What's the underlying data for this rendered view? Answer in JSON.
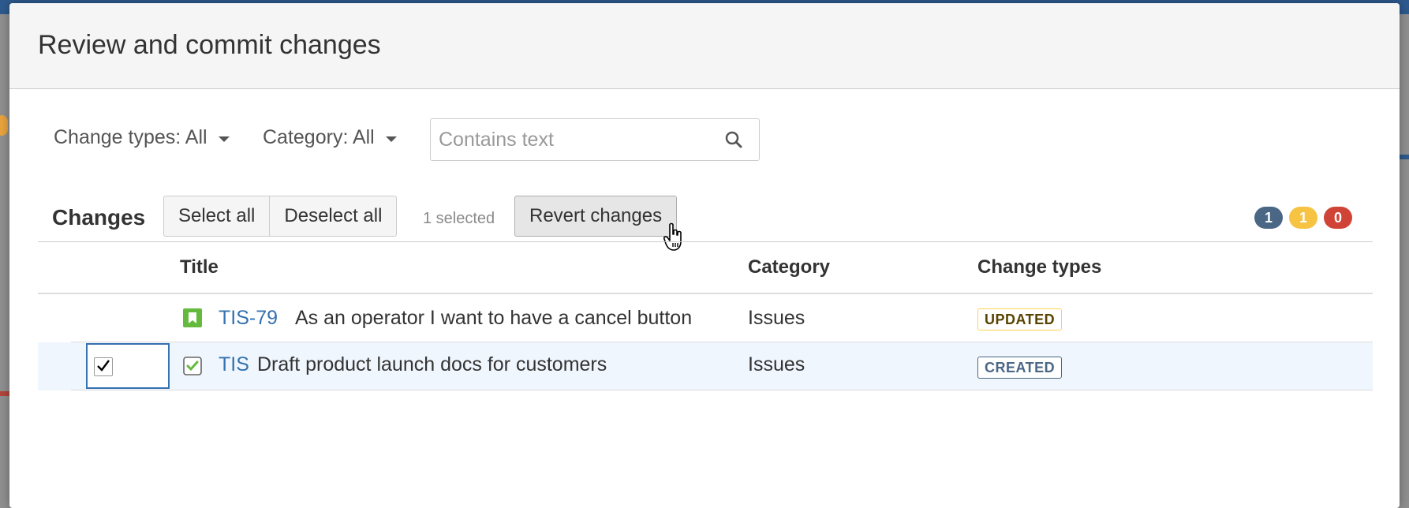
{
  "dialog": {
    "title": "Review and commit changes"
  },
  "filters": {
    "change_types": "Change types: All",
    "category": "Category: All",
    "search_placeholder": "Contains text"
  },
  "toolbar": {
    "changes_label": "Changes",
    "select_all": "Select all",
    "deselect_all": "Deselect all",
    "selected_count": "1 selected",
    "revert": "Revert changes",
    "badges": [
      {
        "value": "1",
        "color": "#4a6785"
      },
      {
        "value": "1",
        "color": "#f6c342"
      },
      {
        "value": "0",
        "color": "#d04437"
      }
    ]
  },
  "table": {
    "headers": {
      "title": "Title",
      "category": "Category",
      "change_types": "Change types"
    },
    "rows": [
      {
        "selected": false,
        "icon": "story-icon",
        "key": "TIS-79",
        "summary": "As an operator I want to have a cancel button",
        "category": "Issues",
        "change_type": "UPDATED",
        "change_type_color": "#594300",
        "change_type_border": "#ffd351"
      },
      {
        "selected": true,
        "icon": "task-icon",
        "key": "TIS",
        "summary": "Draft product launch docs for customers",
        "category": "Issues",
        "change_type": "CREATED",
        "change_type_color": "#4a6785",
        "change_type_border": "#4a6785"
      }
    ]
  }
}
